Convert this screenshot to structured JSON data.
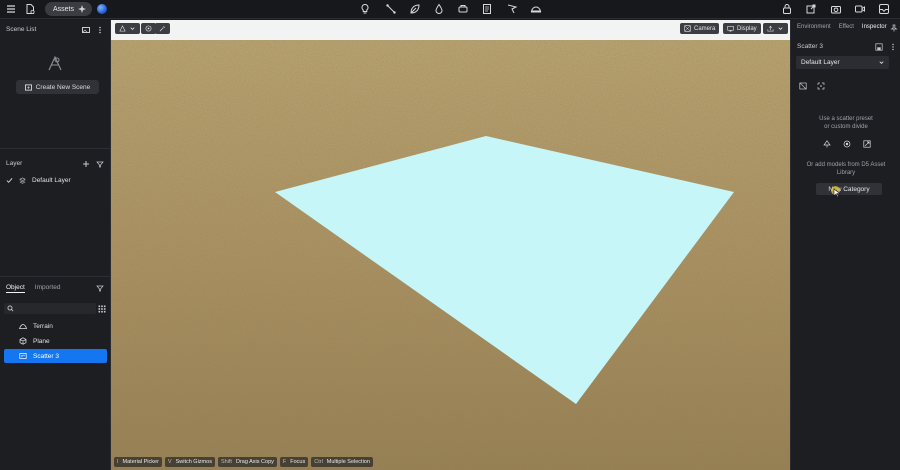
{
  "topbar": {
    "assets_label": "Assets",
    "center_icons": [
      "bulb-icon",
      "path-icon",
      "leaf-icon",
      "drop-icon",
      "vehicle-icon",
      "document-icon",
      "flag-icon",
      "sky-icon"
    ],
    "right_icons": [
      "lock-icon",
      "export-icon",
      "camera-icon",
      "video-icon",
      "tray-icon"
    ]
  },
  "left": {
    "scene_list_title": "Scene List",
    "create_scene_label": "Create New Scene",
    "layer_title": "Layer",
    "layer_item": "Default Layer",
    "tabs": [
      "Object",
      "Imported"
    ],
    "objects": [
      {
        "label": "Terrain",
        "icon": "terrain-icon"
      },
      {
        "label": "Plane",
        "icon": "cube-icon"
      },
      {
        "label": "Scatter 3",
        "icon": "scatter-icon"
      }
    ]
  },
  "viewport": {
    "buttons": {
      "camera": "Camera",
      "display": "Display"
    },
    "status": [
      {
        "key": "I",
        "label": "Material Picker"
      },
      {
        "key": "V",
        "label": "Switch Gizmos"
      },
      {
        "key": "Shift",
        "label": "Drag Axis Copy"
      },
      {
        "key": "F",
        "label": "Focus"
      },
      {
        "key": "Ctrl",
        "label": "Multiple Selection"
      }
    ],
    "colors": {
      "plane": "#c6f6f8",
      "sky": "#f2f3f3",
      "ground": "#b19862"
    }
  },
  "right": {
    "tabs": [
      "Environment",
      "Effect",
      "Inspector"
    ],
    "title": "Scatter 3",
    "layer_value": "Default Layer",
    "hint1": "Use a scatter preset",
    "hint2": "or custom divide",
    "hint3": "Or add models from D5 Asset",
    "hint4": "Library",
    "new_category_label": "New Category"
  }
}
